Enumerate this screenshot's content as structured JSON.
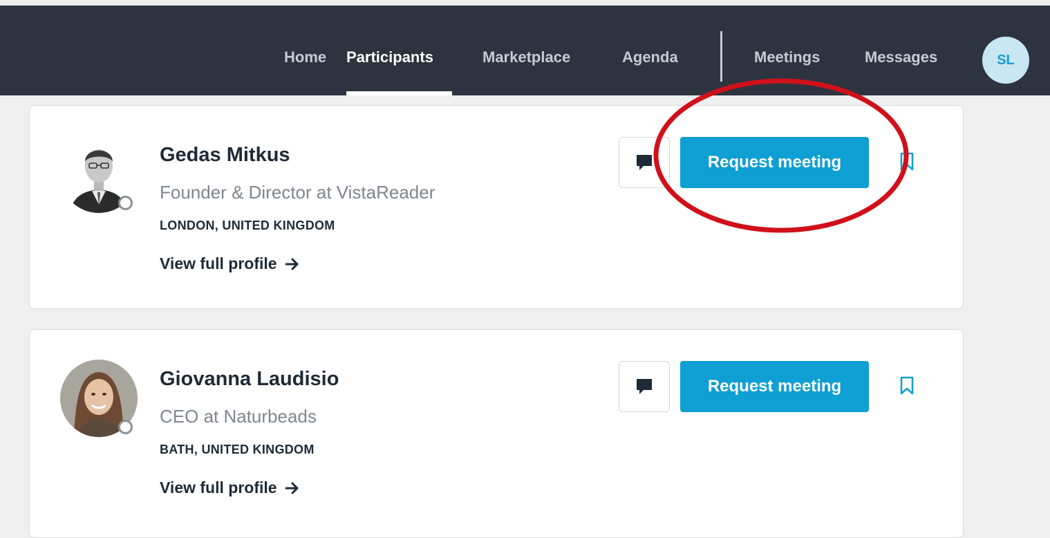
{
  "nav": {
    "items": [
      {
        "label": "Home",
        "active": false
      },
      {
        "label": "Participants",
        "active": true
      },
      {
        "label": "Marketplace",
        "active": false
      },
      {
        "label": "Agenda",
        "active": false
      },
      {
        "label": "Meetings",
        "active": false
      },
      {
        "label": "Messages",
        "active": false
      }
    ],
    "user_initials": "SL"
  },
  "participants": [
    {
      "name": "Gedas Mitkus",
      "title": "Founder & Director at VistaReader",
      "location": "LONDON, UNITED KINGDOM",
      "profile_link": "View full profile",
      "request_label": "Request meeting",
      "online": false
    },
    {
      "name": "Giovanna Laudisio",
      "title": "CEO at Naturbeads",
      "location": "BATH, UNITED KINGDOM",
      "profile_link": "View full profile",
      "request_label": "Request meeting",
      "online": false
    }
  ],
  "colors": {
    "topbar": "#2d3440",
    "accent": "#0e9fd3",
    "highlight_ring": "#d0101a"
  }
}
